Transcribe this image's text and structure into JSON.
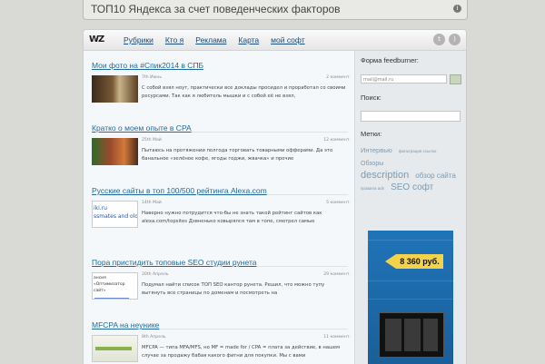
{
  "banner": {
    "text": "ТОП10 Яндекса за счет поведенческих факторов",
    "icon": "info-icon"
  },
  "header": {
    "logo": "WZ",
    "nav": [
      "Рубрики",
      "Кто я",
      "Реклама",
      "Карта",
      "мой софт"
    ],
    "social": [
      "twitter-icon",
      "rss-icon"
    ]
  },
  "posts": [
    {
      "title": "Мои фото на #Спик2014 в СПБ",
      "date": "7th Июнь",
      "comments": "2 коммент.",
      "excerpt": "С собой взял ноут, практически все доклады просидел и проработал со своими ресурсами. Так как я любитель мышки и с собой её не взял,"
    },
    {
      "title": "Кратко о моем опыте в CPA",
      "date": "25th Май",
      "comments": "12 коммент.",
      "excerpt": "Пытаюсь на протяжении полгода торговать товарными офферами. Да это банальное «зелёное кофе, ягоды годжи, жвачка» и прочие"
    },
    {
      "title": "Русские сайты в топ 100/500 рейтинга Alexa.com",
      "date": "14th Май",
      "comments": "5 коммент.",
      "thumb_text": "iki.ru\nssmates and old frien",
      "excerpt": "Наверно нужно потрудится что-бы не знать такой рейтинг сайтов как alexa.com/topsites Дзвненько ковырялся там в топе, смотрел самые"
    },
    {
      "title": "Пора пристидить топовые SEO студии рунета",
      "date": "20th Апрель",
      "comments": "29 коммент.",
      "thumb_text": "ансия «Оптимизатор сайт»",
      "excerpt": "Подумал найти список ТОП SEO кантор рунета. Решил, что можно тупу вытянуть все страницы по доменам и посмотреть на"
    },
    {
      "title": "MFCPA на неунике",
      "date": "8th Апрель",
      "comments": "11 коммент.",
      "excerpt": "MFCPA — типа MFA/MFS, но MF = made for / CPA = плата за действие, в нашем случае за продажу бабая какого фигни для покупки. Мы с вами"
    }
  ],
  "sidebar": {
    "feed_title": "Форма feedburner:",
    "feed_placeholder": "mail@mail.ru",
    "search_title": "Поиск:",
    "tags_title": "Метки:",
    "tags": [
      {
        "text": "Интервью",
        "size": 7.5
      },
      {
        "text": "фильтрация ссылок",
        "size": 4.5
      },
      {
        "text": "Обзоры",
        "size": 7
      },
      {
        "text": "description",
        "size": 11
      },
      {
        "text": "обзор сайта",
        "size": 8
      },
      {
        "text": "правила ads",
        "size": 4.5
      },
      {
        "text": "SEO софт",
        "size": 10
      }
    ],
    "ad_price": "8 360 руб."
  }
}
